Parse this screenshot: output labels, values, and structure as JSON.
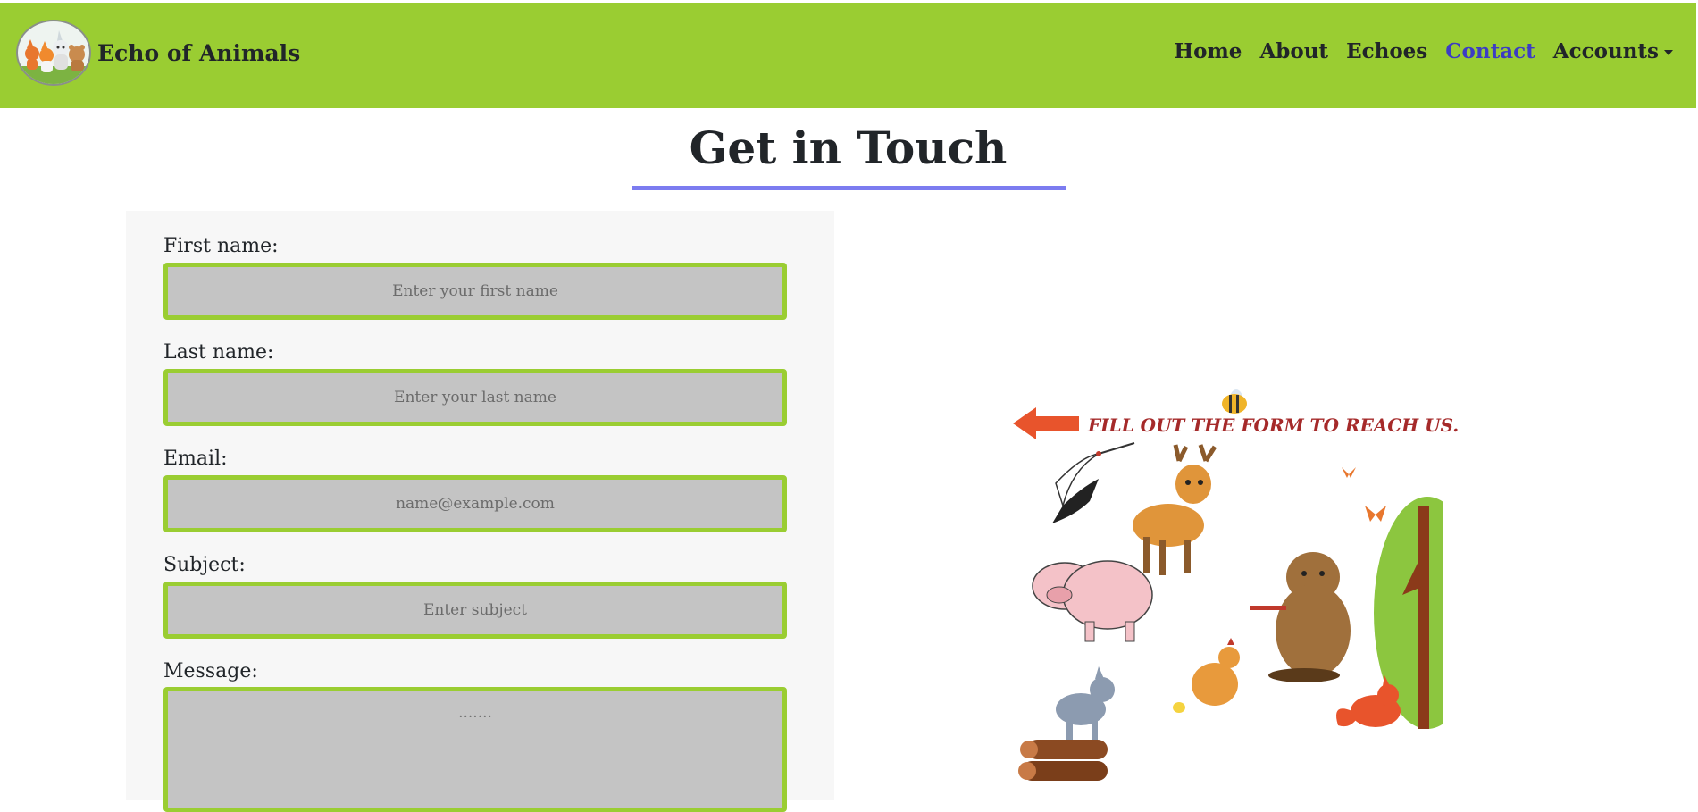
{
  "brand": {
    "name": "Echo of Animals"
  },
  "nav": {
    "items": [
      {
        "label": "Home"
      },
      {
        "label": "About"
      },
      {
        "label": "Echoes"
      },
      {
        "label": "Contact"
      },
      {
        "label": "Accounts"
      }
    ],
    "active": "Contact"
  },
  "page": {
    "title": "Get in Touch"
  },
  "form": {
    "first_name": {
      "label": "First name:",
      "placeholder": "Enter your first name"
    },
    "last_name": {
      "label": "Last name:",
      "placeholder": "Enter your last name"
    },
    "email": {
      "label": "Email:",
      "placeholder": "name@example.com"
    },
    "subject": {
      "label": "Subject:",
      "placeholder": "Enter subject"
    },
    "message": {
      "label": "Message:",
      "placeholder": "......."
    }
  },
  "illustration": {
    "cta": "FILL OUT THE FORM TO REACH US."
  },
  "colors": {
    "navbar_bg": "#9acd32",
    "input_border": "#9acd32",
    "input_bg": "#c4c4c4",
    "active_link": "#3c3cc4",
    "title_underline": "#7c7cf0",
    "cta_text": "#a52a2a",
    "arrow": "#e8542c"
  }
}
